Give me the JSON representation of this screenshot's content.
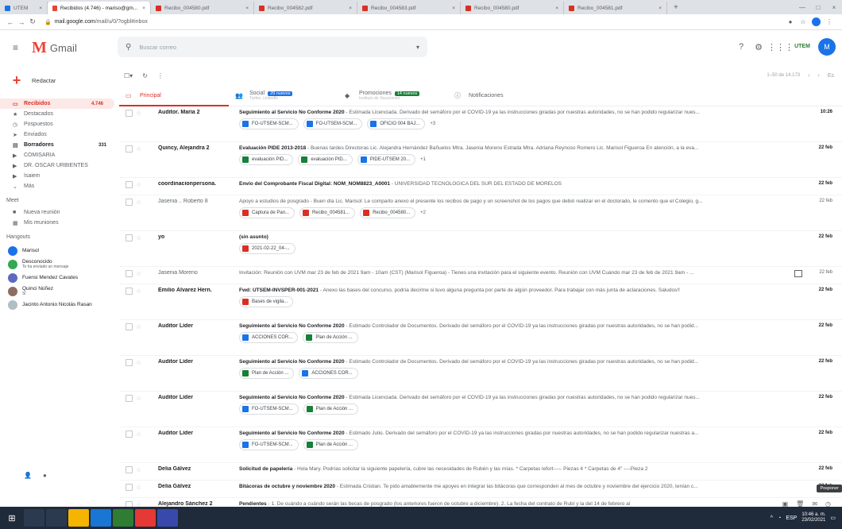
{
  "browser": {
    "tabs": [
      {
        "label": "UTEM",
        "color": "#1a73e8"
      },
      {
        "label": "Recibidos (4.746) - mariso@gm...",
        "color": "#ea4335",
        "active": true
      },
      {
        "label": "Recibo_004580.pdf",
        "color": "#d93025"
      },
      {
        "label": "Recibo_004582.pdf",
        "color": "#d93025"
      },
      {
        "label": "Recibo_004583.pdf",
        "color": "#d93025"
      },
      {
        "label": "Recibo_004580.pdf",
        "color": "#d93025"
      },
      {
        "label": "Recibo_004581.pdf",
        "color": "#d93025"
      }
    ],
    "url_host": "mail.google.com",
    "url_path": "/mail/u/0/?ogbl#inbox"
  },
  "header": {
    "app_name": "Gmail",
    "search_placeholder": "Buscar correo",
    "account_initial": "M",
    "org_logo_text": "UTEM"
  },
  "sidebar": {
    "compose_label": "Redactar",
    "folders": [
      {
        "icon": "inbox-icon",
        "glyph": "▭",
        "label": "Recibidos",
        "count": "4.746",
        "active": true
      },
      {
        "icon": "star-icon",
        "glyph": "★",
        "label": "Destacados",
        "count": ""
      },
      {
        "icon": "clock-icon",
        "glyph": "◷",
        "label": "Pospuestos",
        "count": ""
      },
      {
        "icon": "send-icon",
        "glyph": "➤",
        "label": "Enviados",
        "count": ""
      },
      {
        "icon": "draft-icon",
        "glyph": "▤",
        "label": "Borradores",
        "count": "331",
        "bold": true
      },
      {
        "icon": "label-icon",
        "glyph": "▶",
        "label": "COMISARIA",
        "count": ""
      },
      {
        "icon": "label-icon",
        "glyph": "▶",
        "label": "DR. OSCAR URBIENTES",
        "count": ""
      },
      {
        "icon": "label-icon",
        "glyph": "▶",
        "label": "Isaiem",
        "count": ""
      },
      {
        "icon": "chevron-down-icon",
        "glyph": "⌄",
        "label": "Más",
        "count": ""
      }
    ],
    "meet_title": "Meet",
    "meet_items": [
      {
        "glyph": "■",
        "label": "Nueva reunión"
      },
      {
        "glyph": "▦",
        "label": "Mis reuniones"
      }
    ],
    "hangouts_title": "Hangouts",
    "hangouts": [
      {
        "name": "Marisol",
        "sub": "",
        "color": "#1a73e8"
      },
      {
        "name": "Desconocido",
        "sub": "Te ha enviado un mensaje",
        "color": "#34a853"
      },
      {
        "name": "Fuensi Mendez Cavates",
        "sub": "",
        "color": "#5c6bc0"
      },
      {
        "name": "Quinci Núñez",
        "sub": "Si",
        "color": "#8d6e63"
      },
      {
        "name": "Jacinto Antonio Nicolás Rasan",
        "sub": "",
        "color": "#b0bec5"
      }
    ]
  },
  "main": {
    "pagination": "1–50 de 14.173",
    "lang": "Es",
    "tabs": [
      {
        "icon": "inbox-icon",
        "glyph": "▭",
        "label": "Principal",
        "badge": "",
        "sub": "",
        "active": true
      },
      {
        "icon": "people-icon",
        "glyph": "👥",
        "label": "Social",
        "badge": "29 nuevos",
        "badge_color": "#1a73e8",
        "sub": "Twitter, LinkedIn",
        "active": false
      },
      {
        "icon": "tag-icon",
        "glyph": "◆",
        "label": "Promociones",
        "badge": "14 nuevos",
        "badge_color": "#188038",
        "sub": "Instituto de Vacaciones",
        "active": false
      },
      {
        "icon": "info-icon",
        "glyph": "ⓘ",
        "label": "Notificaciones",
        "badge": "",
        "sub": "",
        "active": false
      }
    ],
    "emails": [
      {
        "sender": "Auditor. María 2",
        "subject": "Seguimiento al Servicio No Conforme 2020",
        "snippet": " - Estimada Licenciada. Derivado del semáforo por el COVID-19 ya las instrucciones giradas por nuestras autoridades, no se han podido regularizar nues...",
        "date": "10:26",
        "read": false,
        "chips": [
          {
            "label": "FO-UTSEM-SCM...",
            "color": "#1a73e8"
          },
          {
            "label": "FO-UTSEM-SCM...",
            "color": "#1a73e8"
          },
          {
            "label": "OFICIO 004 BAJ...",
            "color": "#1a73e8"
          }
        ],
        "more": "+3"
      },
      {
        "sender": "Quincy, Alejandra 2",
        "subject": "Evaluación PIDE 2013-2018",
        "snippet": " - Buenas tardes Directoras Lic. Alejandra Hernández Bañuelos Mtra. Jasenia Moreno Estrada Mtra. Adriana Reynoso Romero Lic. Marisol Figueroa En atención, a la eva...",
        "date": "22 feb",
        "read": false,
        "chips": [
          {
            "label": "evaluación PID...",
            "color": "#188038"
          },
          {
            "label": "evaluación PID...",
            "color": "#188038"
          },
          {
            "label": "PIDE-UTSEM 20...",
            "color": "#1a73e8"
          }
        ],
        "more": "+1"
      },
      {
        "sender": "coordinacionpersona.",
        "subject": "Envío del Comprobante Fiscal Digital: NOM_NOM8823_A0001",
        "snippet": " - UNIVERSIDAD TECNOLOGICA DEL SUR DEL ESTADO DE MORELOS",
        "date": "22 feb",
        "read": false,
        "chips": [],
        "more": ""
      },
      {
        "sender": "Jasenia .. Roberto 8",
        "subject": "Apoyo a estudios de posgrado",
        "snippet": " - Buen día Lic. Marisol: Le comparto anexo el presente los recibos de pago y un screenshot de los pagos que debió realizar en el doctorado, le comento que el Colegio, g...",
        "date": "22 feb",
        "read": true,
        "chips": [
          {
            "label": "Captura de Pan...",
            "color": "#d93025"
          },
          {
            "label": "Recibo_004581...",
            "color": "#d93025"
          },
          {
            "label": "Recibo_004580...",
            "color": "#d93025"
          }
        ],
        "more": "+2"
      },
      {
        "sender": "yo",
        "subject": "(sin asunto)",
        "snippet": "",
        "date": "22 feb",
        "read": false,
        "chips": [
          {
            "label": "2021-02-22_04-...",
            "color": "#d93025"
          }
        ],
        "more": ""
      },
      {
        "sender": "Jasenia Moreno",
        "subject": "Invitación: Reunión con UVM mar 23 de feb de 2021 9am - 10am (CST) (Marisol Figueroa)",
        "snippet": " - Tienes una invitación para el siguiente evento. Reunión con UVM Cuándo mar 23 de feb de 2021 9am - ...",
        "date": "22 feb",
        "read": true,
        "cal": true,
        "chips": [],
        "more": ""
      },
      {
        "sender": "Emilio Álvarez Hern.",
        "subject": "Fwd: UTSEM-INVSPER-001-2021",
        "snippet": " - Anexo las bases del concurso, podría decirme si tuvo alguna pregunta por parte de algún proveedor. Para trabajar con más junta de aclaraciones. Saludos!!",
        "date": "22 feb",
        "read": false,
        "chips": [
          {
            "label": "Bases de vigila...",
            "color": "#d93025"
          }
        ],
        "more": ""
      },
      {
        "sender": "Auditor Líder",
        "subject": "Seguimiento al Servicio No Conforme 2020",
        "snippet": " - Estimado Controlador de Documentos. Derivado del semáforo por el COVID-19 ya las instrucciones giradas por nuestras autoridades, no se han podid...",
        "date": "22 feb",
        "read": false,
        "chips": [
          {
            "label": "ACCIONES COR...",
            "color": "#1a73e8"
          },
          {
            "label": "Plan de Acción ...",
            "color": "#188038"
          }
        ],
        "more": ""
      },
      {
        "sender": "Auditor Líder",
        "subject": "Seguimiento al Servicio No Conforme 2020",
        "snippet": " - Estimado Controlador de Documentos. Derivado del semáforo por el COVID-19 ya las instrucciones giradas por nuestras autoridades, no se han podid...",
        "date": "22 feb",
        "read": false,
        "chips": [
          {
            "label": "Plan de Acción ...",
            "color": "#188038"
          },
          {
            "label": "ACCIONES COR...",
            "color": "#1a73e8"
          }
        ],
        "more": ""
      },
      {
        "sender": "Auditor Líder",
        "subject": "Seguimiento al Servicio No Conforme 2020",
        "snippet": " - Estimada Licenciada. Derivado del semáforo por el COVID-19 ya las instrucciones giradas por nuestras autoridades, no se han podido regularizar nues...",
        "date": "22 feb",
        "read": false,
        "chips": [
          {
            "label": "FO-UTSEM-SCM...",
            "color": "#1a73e8"
          },
          {
            "label": "Plan de Acción ...",
            "color": "#188038"
          }
        ],
        "more": ""
      },
      {
        "sender": "Auditor Líder",
        "subject": "Seguimiento al Servicio No Conforme 2020",
        "snippet": " - Estimado Julio. Derivado del semáforo por el COVID-19 ya las instrucciones giradas por nuestras autoridades, no se han podido regularizar nuestras a...",
        "date": "22 feb",
        "read": false,
        "chips": [
          {
            "label": "FO-UTSEM-SCM...",
            "color": "#1a73e8"
          },
          {
            "label": "Plan de Acción ...",
            "color": "#188038"
          }
        ],
        "more": ""
      },
      {
        "sender": "Delia Gálvez",
        "subject": "Solicitud de papelería",
        "snippet": " - Hola Mary. Podrías solicitar la siguiente papelería, cubre las necesidades de Rubén y las mías. * Carpetas lefort----- Piezas 4 * Carpetas de 4\" ----Pieza 2",
        "date": "22 feb",
        "read": false,
        "chips": [],
        "more": ""
      },
      {
        "sender": "Delia Gálvez",
        "subject": "Bitácoras de octubre y noviembre 2020",
        "snippet": " - Estimada Cristian. Te pido amablemente me apoyes en integrar las bitácoras que corresponden al mes de octubre y noviembre del ejercicio 2020, tenían c...",
        "date": "22 feb",
        "read": false,
        "chips": [],
        "more": ""
      },
      {
        "sender": "Alejandro Sánchez 2",
        "subject": "Pendientes",
        "snippet": " - 1. De cuándo a cuándo serán las becas de posgrado (los anteriores fueron de octubre a diciembre). 2. La fecha del contrato de Rubí y la del 14 de febrero al",
        "date": "",
        "read": false,
        "chips": [],
        "more": "",
        "last": true
      }
    ],
    "tooltip": "Posponer"
  },
  "taskbar": {
    "time": "10:46 a. m.",
    "date": "23/02/2021",
    "lang": "ESP"
  }
}
